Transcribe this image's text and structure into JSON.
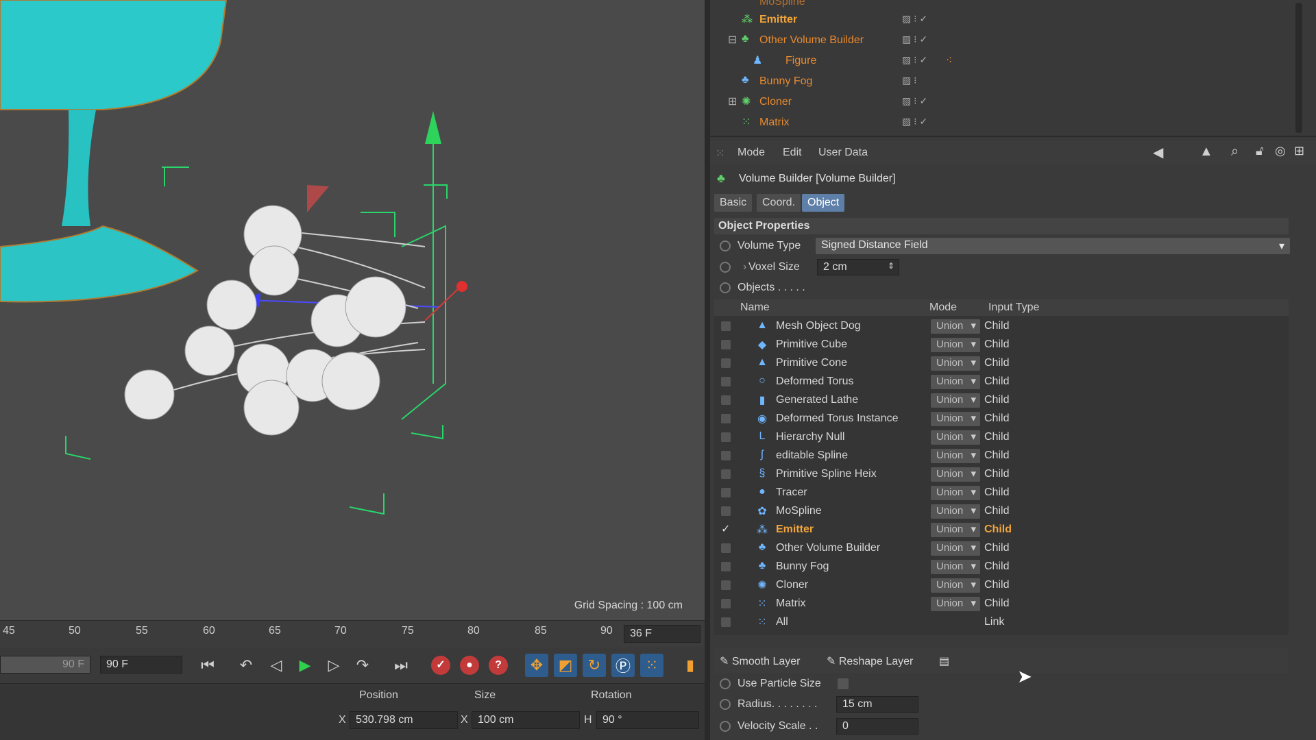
{
  "viewport": {
    "grid_spacing": "Grid Spacing : 100 cm"
  },
  "timeline": {
    "ticks": [
      "45",
      "50",
      "55",
      "60",
      "65",
      "70",
      "75",
      "80",
      "85",
      "90"
    ],
    "current_frame": "36 F"
  },
  "transport": {
    "start_frame": "90 F",
    "end_frame": "90 F"
  },
  "coords": {
    "headers": {
      "position": "Position",
      "size": "Size",
      "rotation": "Rotation"
    },
    "x_label": "X",
    "x_position": "530.798 cm",
    "x_size": "100 cm",
    "h_label": "H",
    "h_rotation": "90 °"
  },
  "object_manager": {
    "items": [
      {
        "name": "MoSpline",
        "active": false
      },
      {
        "name": "Emitter",
        "active": true
      },
      {
        "name": "Other Volume Builder",
        "active": false
      },
      {
        "name": "Figure",
        "active": false
      },
      {
        "name": "Bunny Fog",
        "active": false
      },
      {
        "name": "Cloner",
        "active": false
      },
      {
        "name": "Matrix",
        "active": false
      }
    ]
  },
  "attributes": {
    "menu": [
      "Mode",
      "Edit",
      "User Data"
    ],
    "title": "Volume Builder [Volume Builder]",
    "tabs": [
      "Basic",
      "Coord.",
      "Object"
    ],
    "active_tab": "Object",
    "section": "Object Properties",
    "volume_type_label": "Volume Type",
    "volume_type_value": "Signed Distance Field",
    "voxel_size_label": "Voxel Size",
    "voxel_size_value": "2 cm",
    "objects_label": "Objects . . . . .",
    "list_headers": {
      "name": "Name",
      "mode": "Mode",
      "input_type": "Input Type"
    },
    "list": [
      {
        "name": "Mesh Object Dog",
        "mode": "Union",
        "input": "Child",
        "icon": "▲",
        "checked": false
      },
      {
        "name": "Primitive Cube",
        "mode": "Union",
        "input": "Child",
        "icon": "◆",
        "checked": false
      },
      {
        "name": "Primitive Cone",
        "mode": "Union",
        "input": "Child",
        "icon": "▲",
        "checked": false
      },
      {
        "name": "Deformed Torus",
        "mode": "Union",
        "input": "Child",
        "icon": "○",
        "checked": false
      },
      {
        "name": "Generated Lathe",
        "mode": "Union",
        "input": "Child",
        "icon": "▮",
        "checked": false
      },
      {
        "name": "Deformed Torus Instance",
        "mode": "Union",
        "input": "Child",
        "icon": "◉",
        "checked": false
      },
      {
        "name": "Hierarchy Null",
        "mode": "Union",
        "input": "Child",
        "icon": "L",
        "checked": false
      },
      {
        "name": "editable Spline",
        "mode": "Union",
        "input": "Child",
        "icon": "∫",
        "checked": false
      },
      {
        "name": "Primitive Spline Heix",
        "mode": "Union",
        "input": "Child",
        "icon": "§",
        "checked": false
      },
      {
        "name": "Tracer",
        "mode": "Union",
        "input": "Child",
        "icon": "●",
        "checked": false
      },
      {
        "name": "MoSpline",
        "mode": "Union",
        "input": "Child",
        "icon": "✿",
        "checked": false
      },
      {
        "name": "Emitter",
        "mode": "Union",
        "input": "Child",
        "icon": "⁂",
        "checked": true,
        "active": true
      },
      {
        "name": "Other Volume Builder",
        "mode": "Union",
        "input": "Child",
        "icon": "♣",
        "checked": false
      },
      {
        "name": "Bunny Fog",
        "mode": "Union",
        "input": "Child",
        "icon": "♣",
        "checked": false
      },
      {
        "name": "Cloner",
        "mode": "Union",
        "input": "Child",
        "icon": "✺",
        "checked": false
      },
      {
        "name": "Matrix",
        "mode": "Union",
        "input": "Child",
        "icon": "⁙",
        "checked": false
      },
      {
        "name": "All",
        "mode": "",
        "input": "Link",
        "icon": "⁙",
        "checked": false
      }
    ],
    "layer_buttons": {
      "smooth": "Smooth Layer",
      "reshape": "Reshape Layer"
    },
    "use_particle_size_label": "Use Particle Size",
    "radius_label": "Radius. . . . . . . .",
    "radius_value": "15 cm",
    "velocity_label": "Velocity Scale . .",
    "velocity_value": "0"
  },
  "colors": {
    "accent_orange": "#f2a53a",
    "cyan_object": "#27c7c7",
    "tab_active": "#5d7fa8"
  }
}
